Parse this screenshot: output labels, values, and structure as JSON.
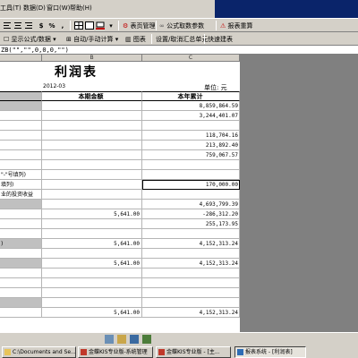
{
  "menu": {
    "items": [
      "工具(T)",
      "数据(D)",
      "窗口(W)",
      "帮助(H)"
    ]
  },
  "toolbar1": {
    "report_manager_label": "表页管理",
    "formula_check_label": "公式取数参数",
    "recalc_label": "报表重算"
  },
  "toolbar2": {
    "show_formula_label": "显示公式/数据",
    "auto_manual_label": "自动/手动计算",
    "chart_label": "图表",
    "set_cancel_summary_label": "设置/取消汇总单元",
    "quick_report_label": "快速建表"
  },
  "formula_bar": {
    "text": "ZB(\"\",\"\",0,0,0,\"\")"
  },
  "sheet": {
    "columns": [
      "B",
      "C"
    ],
    "title": "利润表",
    "date": "2012-03",
    "unit": "单位: 元",
    "header": {
      "c1": "本期金额",
      "c2": "本年累计"
    },
    "rows": [
      {
        "label": "",
        "c1": "",
        "c2": "8,859,864.59",
        "shade": true
      },
      {
        "label": "",
        "c1": "",
        "c2": "3,244,401.07",
        "shade": false
      },
      {
        "label": "",
        "c1": "",
        "c2": "",
        "shade": false
      },
      {
        "label": "",
        "c1": "",
        "c2": "118,704.16",
        "shade": false
      },
      {
        "label": "",
        "c1": "",
        "c2": "213,892.40",
        "shade": false
      },
      {
        "label": "",
        "c1": "",
        "c2": "759,067.57",
        "shade": false
      },
      {
        "label": "",
        "c1": "",
        "c2": "",
        "shade": false
      },
      {
        "label": "\"-\"号填列)",
        "c1": "",
        "c2": "",
        "shade": false
      },
      {
        "label": "填列)",
        "c1": "",
        "c2": "170,000.00",
        "shade": false,
        "selected": true
      },
      {
        "label": "业的投资收益",
        "c1": "",
        "c2": "",
        "shade": false
      },
      {
        "label": "",
        "c1": "",
        "c2": "4,693,799.39",
        "shade": true
      },
      {
        "label": "",
        "c1": "5,641.00",
        "c2": "-286,312.20",
        "shade": false
      },
      {
        "label": "",
        "c1": "",
        "c2": "255,173.95",
        "shade": false
      },
      {
        "label": "",
        "c1": "",
        "c2": "",
        "shade": false
      },
      {
        "label": ")",
        "c1": "5,641.00",
        "c2": "4,152,313.24",
        "shade": true
      },
      {
        "label": "",
        "c1": "",
        "c2": "",
        "shade": false
      },
      {
        "label": "",
        "c1": "5,641.00",
        "c2": "4,152,313.24",
        "shade": true
      },
      {
        "label": "",
        "c1": "",
        "c2": "",
        "shade": false
      },
      {
        "label": "",
        "c1": "",
        "c2": "",
        "shade": false
      },
      {
        "label": "",
        "c1": "",
        "c2": "",
        "shade": false
      },
      {
        "label": "",
        "c1": "",
        "c2": "",
        "shade": true
      },
      {
        "label": "",
        "c1": "5,641.00",
        "c2": "4,152,313.24",
        "shade": false
      }
    ]
  },
  "taskbar": {
    "buttons": [
      {
        "label": "C:\\Documents and Se...",
        "active": false
      },
      {
        "label": "金蝶KIS专业版-系统管理",
        "active": false
      },
      {
        "label": "金蝶KIS专业版 - [主...",
        "active": false
      },
      {
        "label": "报表系统 - [利润表]",
        "active": true
      }
    ]
  },
  "colors": {
    "chrome": "#d4d0c8",
    "header_shade": "#c0c0c0",
    "workspace": "#808080",
    "title_bar": "#0a246a"
  }
}
